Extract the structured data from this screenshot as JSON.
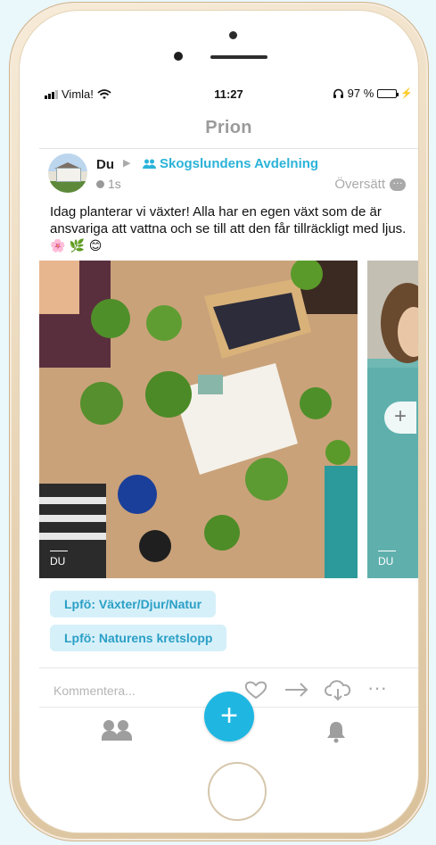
{
  "status_bar": {
    "carrier": "Vimla!",
    "time": "11:27",
    "battery": "97 %"
  },
  "nav": {
    "title": "Prion"
  },
  "post": {
    "author": "Du",
    "group": "Skogslundens Avdelning",
    "age": "1s",
    "translate": "Översätt",
    "text": "Idag planterar vi växter! Alla har en egen växt som de är ansvariga att vattna och se till att den får tillräckligt med ljus.",
    "emojis": "🌸 🌿 😊",
    "photos": [
      {
        "tag": "DU"
      },
      {
        "tag": "DU"
      }
    ],
    "tags": [
      "Lpfö: Växter/Djur/Natur",
      "Lpfö: Naturens kretslopp"
    ]
  },
  "comment": {
    "placeholder": "Kommentera..."
  },
  "icons": {
    "signal": "signal-bars-icon",
    "wifi": "wifi-icon",
    "headphones": "headphones-icon",
    "battery": "battery-icon",
    "group": "group-icon",
    "clock": "clock-icon",
    "translate": "speech-bubble-icon",
    "like": "heart-icon",
    "share": "arrow-right-icon",
    "download": "cloud-download-icon",
    "more": "ellipsis-icon",
    "friends": "friends-icon",
    "add": "plus-icon",
    "notifications": "bell-icon"
  },
  "colors": {
    "accent": "#1fb7e2",
    "chip_bg": "#d6f0f9",
    "chip_text": "#2a9fc6"
  }
}
